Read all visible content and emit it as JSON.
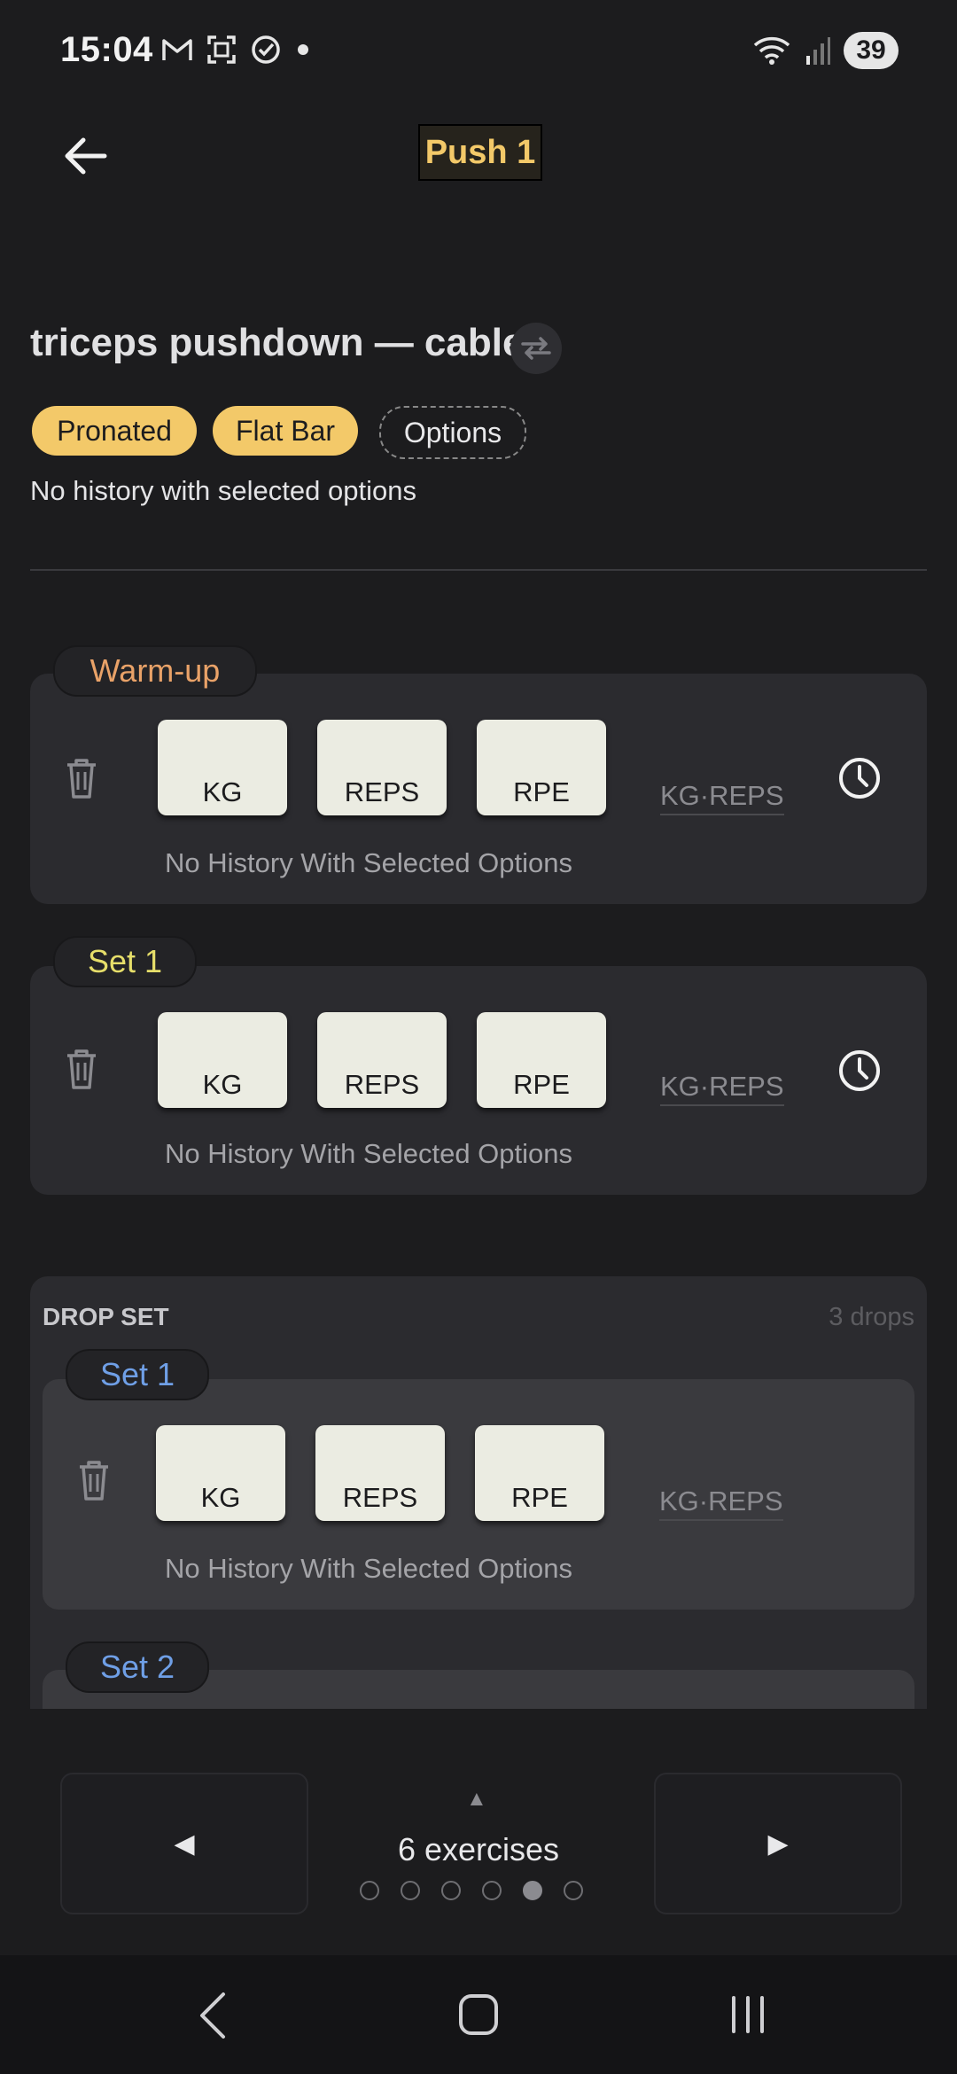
{
  "status": {
    "time": "15:04",
    "battery": "39",
    "wifi_label": "5"
  },
  "header": {
    "title": "Push 1"
  },
  "exercise": {
    "name": "triceps pushdown — cable",
    "chips": [
      "Pronated",
      "Flat Bar",
      "Options"
    ],
    "history_note": "No history with selected options"
  },
  "sets": [
    {
      "label": "Warm-up",
      "color": "#e9a268",
      "inputs": [
        "KG",
        "REPS",
        "RPE"
      ],
      "kgreps": "KG·REPS",
      "history": "No History With Selected Options"
    },
    {
      "label": "Set 1",
      "color": "#e6de6a",
      "inputs": [
        "KG",
        "REPS",
        "RPE"
      ],
      "kgreps": "KG·REPS",
      "history": "No History With Selected Options"
    }
  ],
  "drop_set": {
    "title": "DROP SET",
    "count": "3 drops",
    "sets": [
      {
        "label": "Set 1",
        "color": "#6f9fe6",
        "inputs": [
          "KG",
          "REPS",
          "RPE"
        ],
        "kgreps": "KG·REPS",
        "history": "No History With Selected Options"
      },
      {
        "label": "Set 2",
        "color": "#6f9fe6"
      }
    ]
  },
  "bottom": {
    "prev": "◀",
    "next": "▶",
    "up": "▲",
    "label": "6 exercises",
    "dots": 6,
    "active_dot": 5
  },
  "icons": [
    "back-arrow-icon",
    "swap-icon",
    "trash-icon",
    "clock-icon",
    "home-icon",
    "recents-icon"
  ]
}
